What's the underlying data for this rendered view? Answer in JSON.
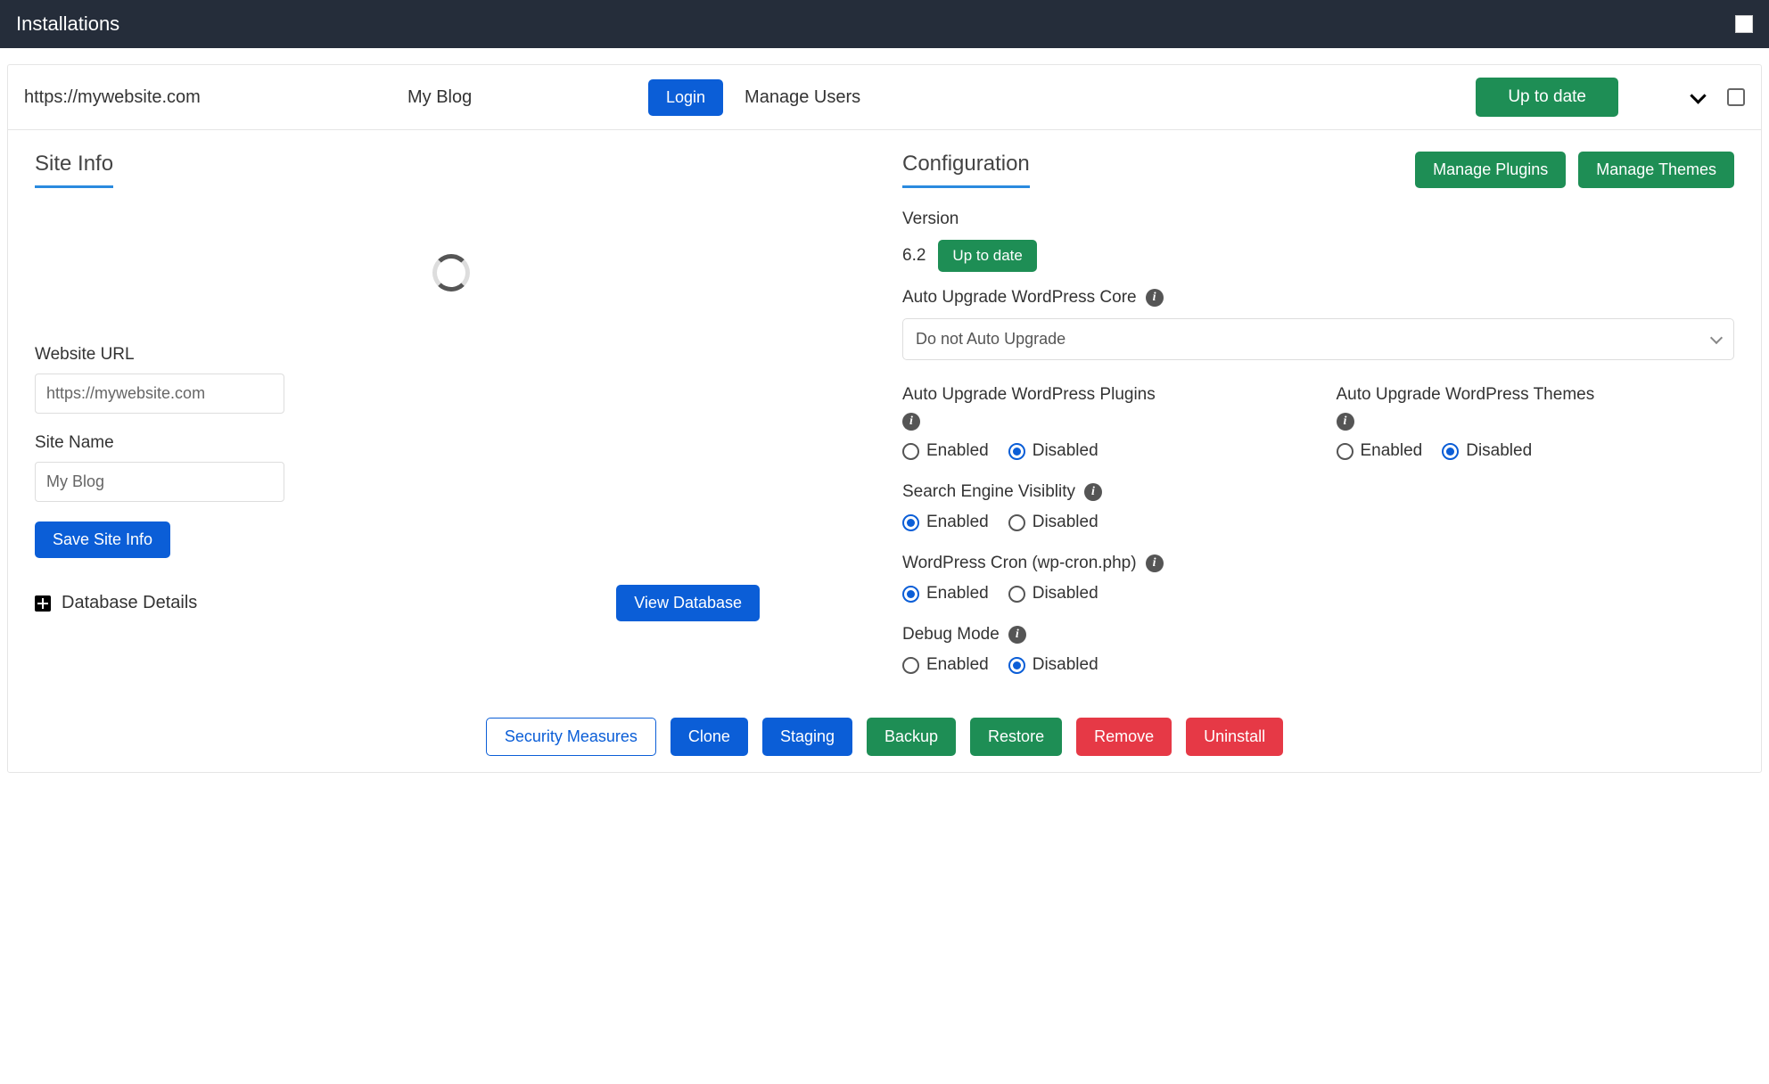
{
  "topbar": {
    "title": "Installations"
  },
  "header": {
    "url": "https://mywebsite.com",
    "name": "My Blog",
    "login_btn": "Login",
    "manage_users": "Manage Users",
    "status_btn": "Up to date"
  },
  "siteinfo": {
    "title": "Site Info",
    "url_label": "Website URL",
    "url_value": "https://mywebsite.com",
    "name_label": "Site Name",
    "name_value": "My Blog",
    "save_btn": "Save Site Info",
    "db_details": "Database Details",
    "view_db_btn": "View Database"
  },
  "config": {
    "title": "Configuration",
    "manage_plugins_btn": "Manage Plugins",
    "manage_themes_btn": "Manage Themes",
    "version_label": "Version",
    "version_value": "6.2",
    "version_badge": "Up to date",
    "auto_core_label": "Auto Upgrade WordPress Core",
    "auto_core_value": "Do not Auto Upgrade",
    "auto_plugins_label": "Auto Upgrade WordPress Plugins",
    "auto_themes_label": "Auto Upgrade WordPress Themes",
    "sev_label": "Search Engine Visiblity",
    "cron_label": "WordPress Cron (wp-cron.php)",
    "debug_label": "Debug Mode",
    "opt_enabled": "Enabled",
    "opt_disabled": "Disabled"
  },
  "footer": {
    "security": "Security Measures",
    "clone": "Clone",
    "staging": "Staging",
    "backup": "Backup",
    "restore": "Restore",
    "remove": "Remove",
    "uninstall": "Uninstall"
  }
}
